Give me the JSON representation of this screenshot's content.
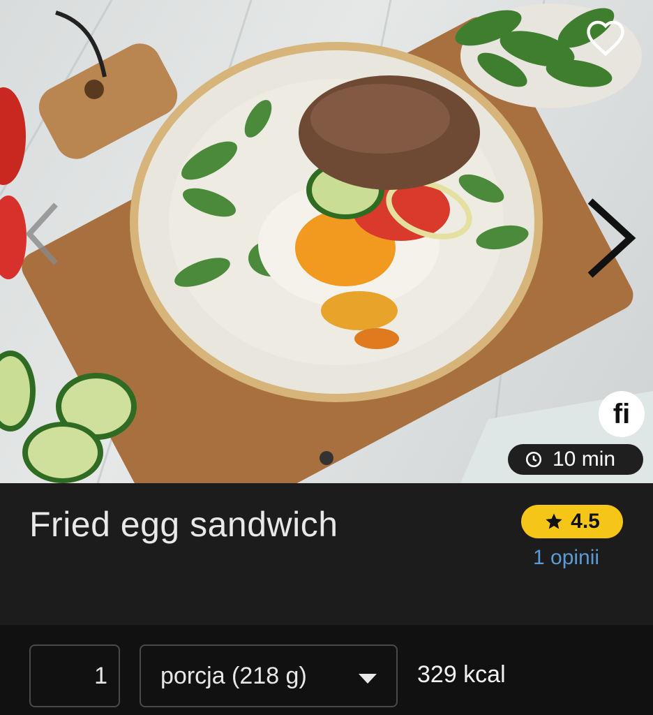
{
  "recipe": {
    "title": "Fried egg sandwich",
    "prep_time": "10 min",
    "rating": "4.5",
    "reviews_label": "1 opinii",
    "badge_text": "fi",
    "image_description_icon": "food-photo"
  },
  "serving": {
    "quantity": "1",
    "unit": "porcja (218 g)",
    "calories": "329 kcal"
  },
  "carousel": {
    "total_dots": 1,
    "active_index": 0
  },
  "colors": {
    "rating_badge": "#f5c518",
    "reviews_link": "#5b9bd5",
    "title_band": "#1c1c1c",
    "background": "#111111"
  },
  "icons": {
    "favorite": "heart-outline-icon",
    "prev": "chevron-left-icon",
    "next": "chevron-right-icon",
    "time": "clock-icon",
    "rating": "star-icon",
    "dropdown": "caret-down-icon"
  }
}
